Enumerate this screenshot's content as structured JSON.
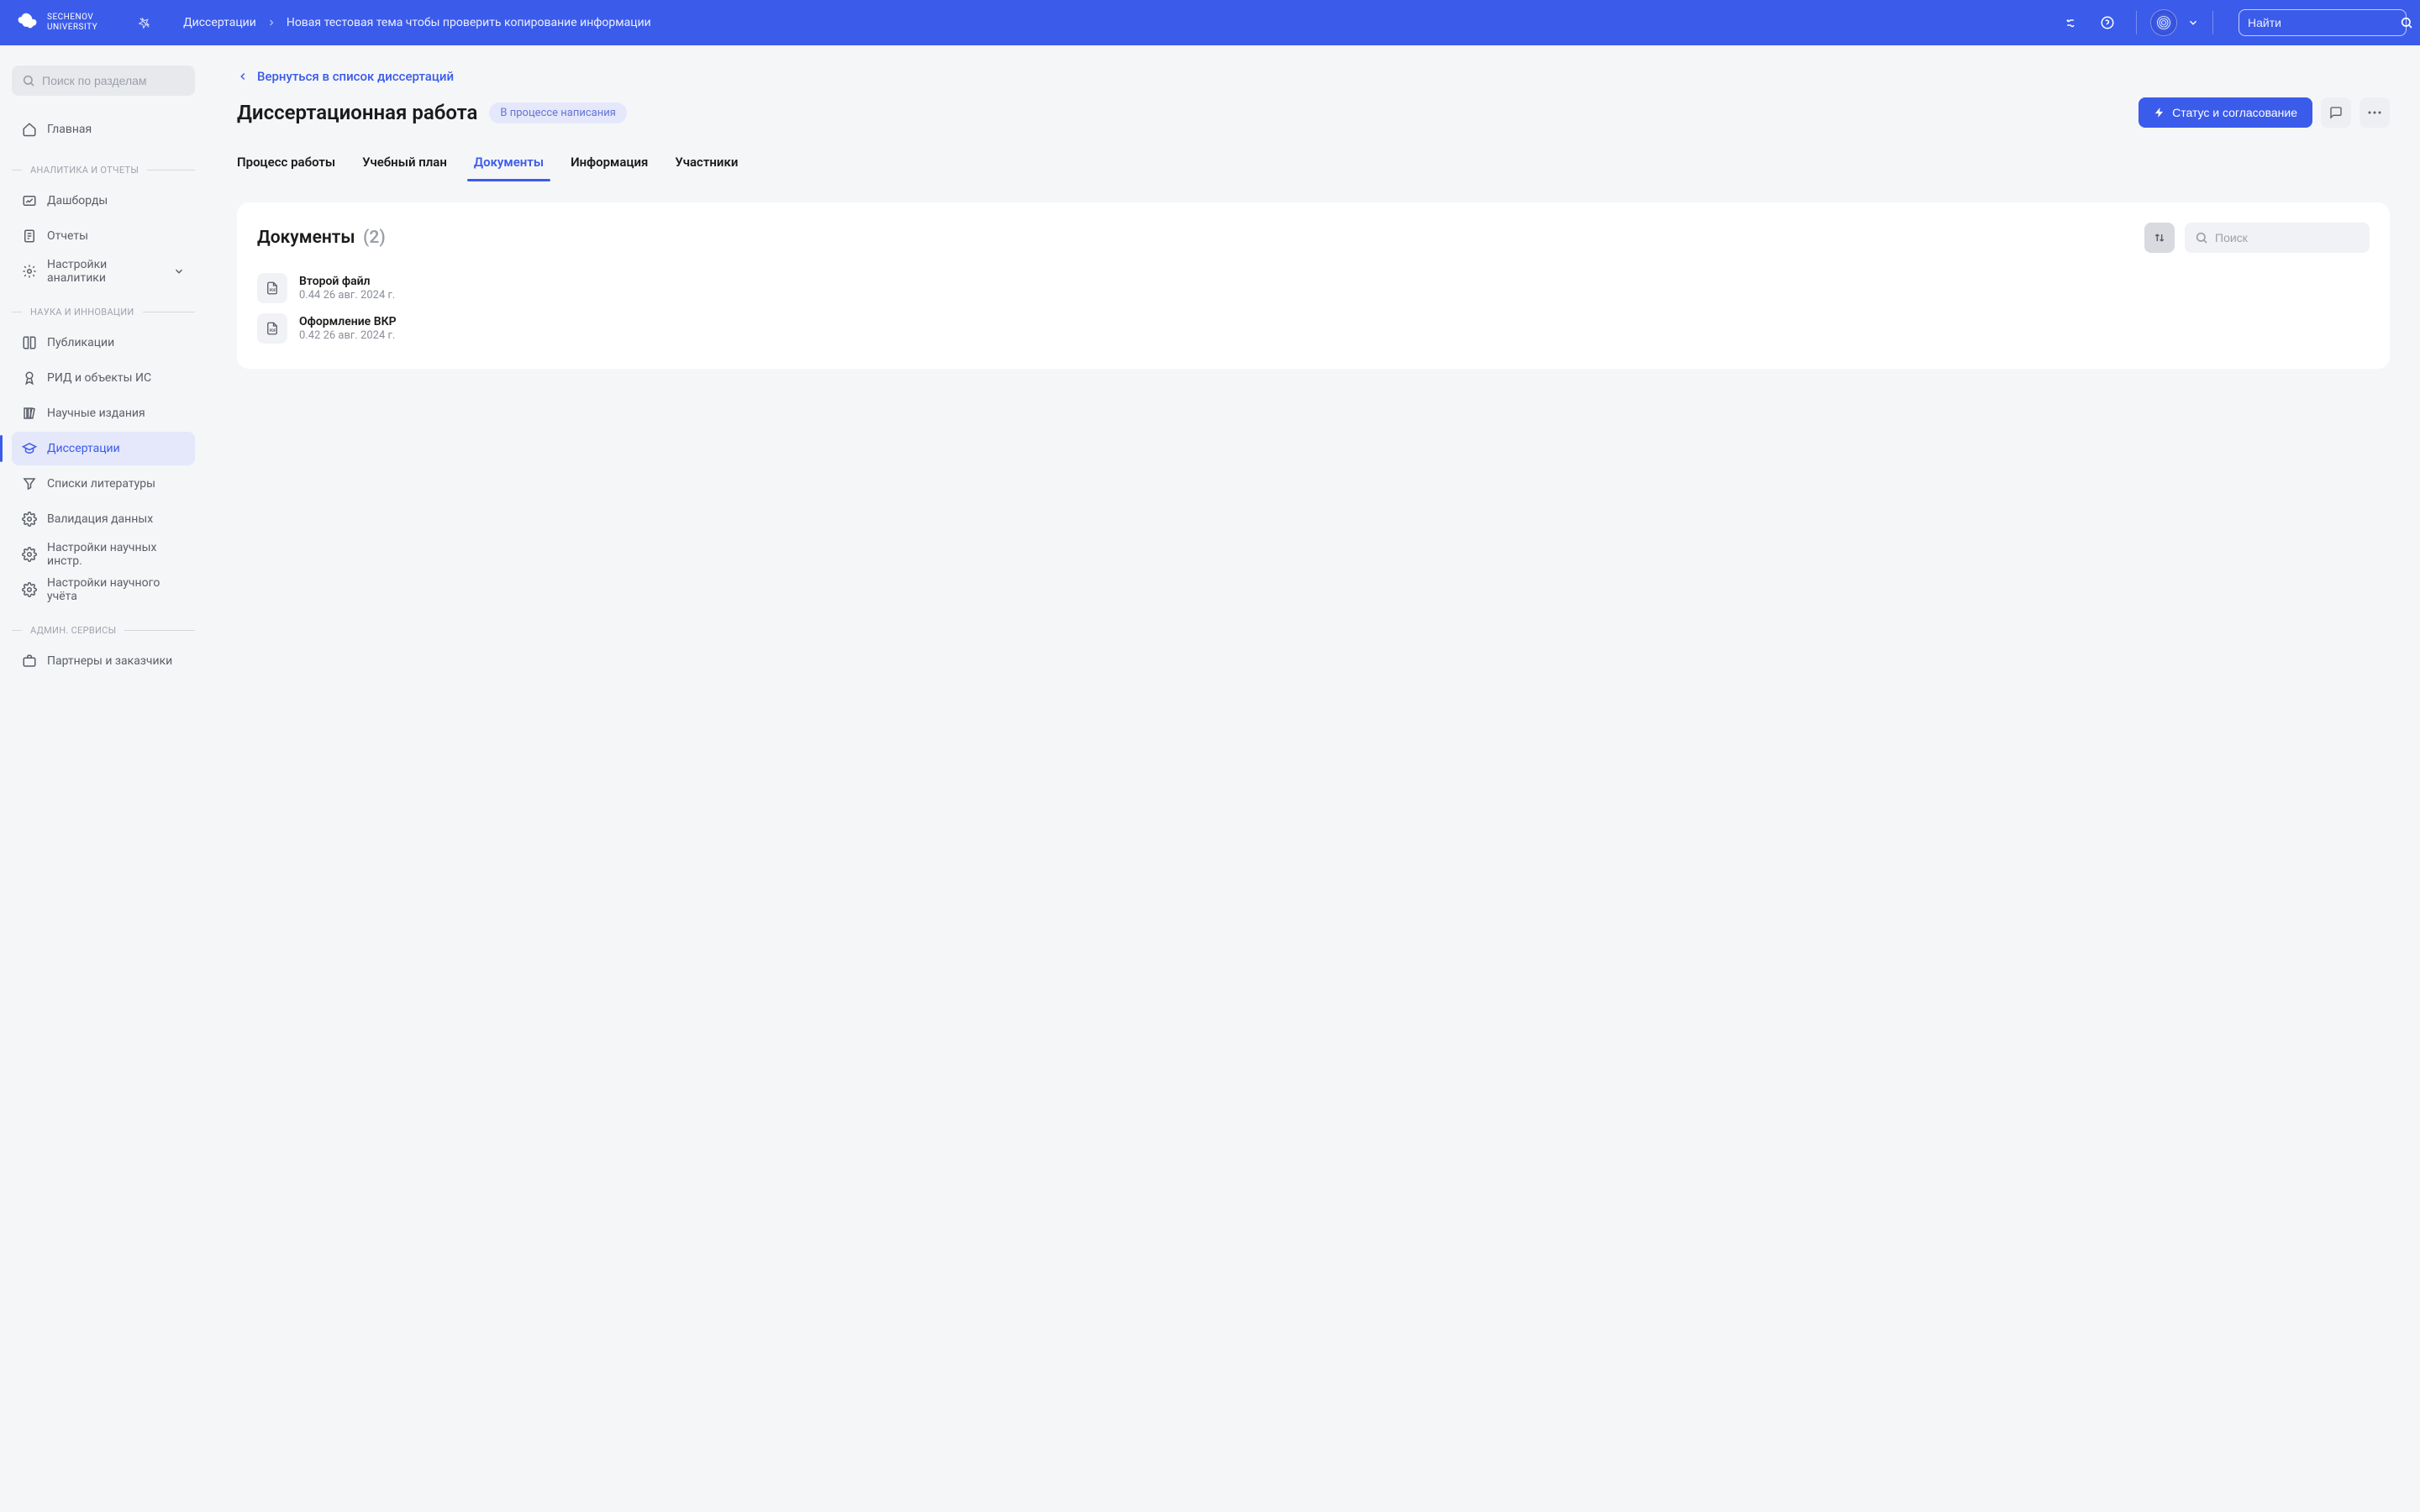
{
  "header": {
    "logo_line1": "SECHENOV",
    "logo_line2": "UNIVERSITY",
    "breadcrumb": [
      "Диссертации",
      "Новая тестовая тема чтобы проверить копирование информации"
    ],
    "search_placeholder": "Найти"
  },
  "sidebar": {
    "search_placeholder": "Поиск по разделам",
    "home": "Главная",
    "sections": [
      {
        "title": "АНАЛИТИКА И ОТЧЕТЫ",
        "items": [
          {
            "label": "Дашборды",
            "icon": "dashboard"
          },
          {
            "label": "Отчеты",
            "icon": "report"
          },
          {
            "label": "Настройки аналитики",
            "icon": "gear",
            "expandable": true
          }
        ]
      },
      {
        "title": "НАУКА И ИННОВАЦИИ",
        "items": [
          {
            "label": "Публикации",
            "icon": "book"
          },
          {
            "label": "РИД и объекты ИС",
            "icon": "award"
          },
          {
            "label": "Научные издания",
            "icon": "library"
          },
          {
            "label": "Диссертации",
            "icon": "cap",
            "active": true
          },
          {
            "label": "Списки литературы",
            "icon": "filter"
          },
          {
            "label": "Валидация данных",
            "icon": "gear2"
          },
          {
            "label": "Настройки научных инстр.",
            "icon": "gear2"
          },
          {
            "label": "Настройки научного учёта",
            "icon": "gear2"
          }
        ]
      },
      {
        "title": "АДМИН. СЕРВИСЫ",
        "items": [
          {
            "label": "Партнеры и заказчики",
            "icon": "briefcase"
          }
        ]
      }
    ]
  },
  "main": {
    "back_label": "Вернуться в список диссертаций",
    "title": "Диссертационная работа",
    "status": "В процессе написания",
    "action_label": "Статус и согласование",
    "tabs": [
      "Процесс работы",
      "Учебный план",
      "Документы",
      "Информация",
      "Участники"
    ],
    "active_tab_index": 2,
    "docs": {
      "title": "Документы",
      "count": "(2)",
      "search_placeholder": "Поиск",
      "items": [
        {
          "name": "Второй файл",
          "meta": "0.44 26 авг. 2024 г."
        },
        {
          "name": "Оформление ВКР",
          "meta": "0.42 26 авг. 2024 г."
        }
      ]
    }
  }
}
